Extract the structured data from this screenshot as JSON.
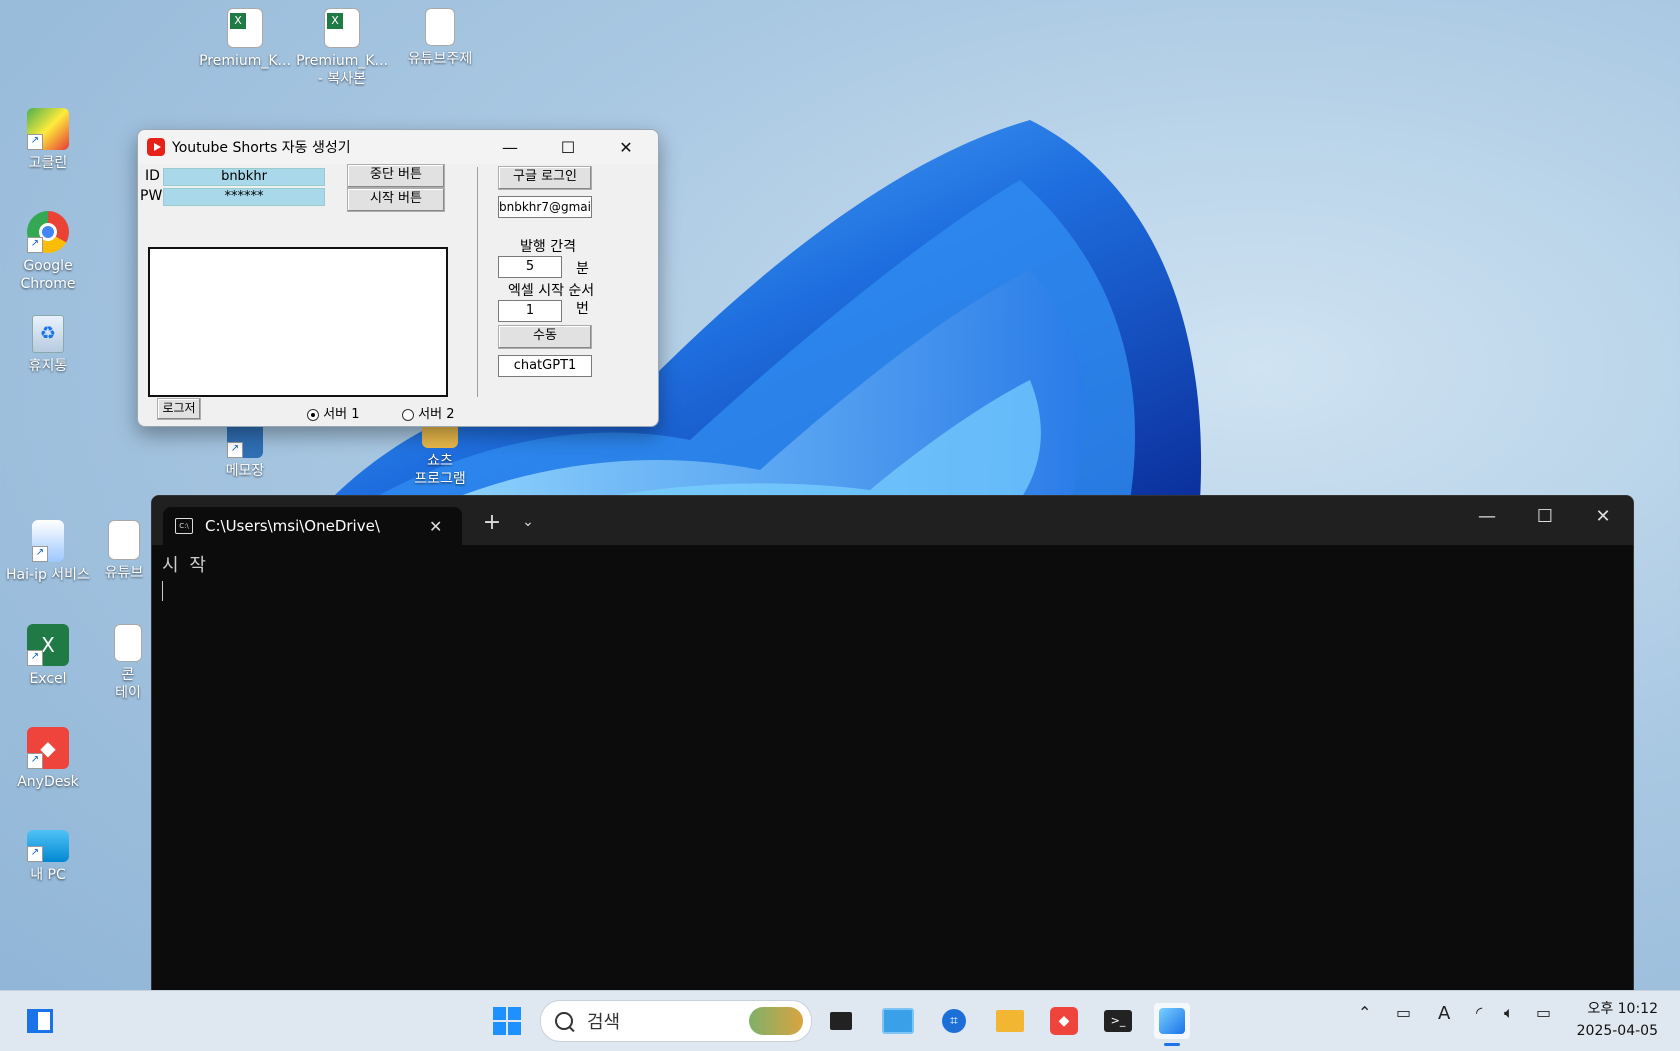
{
  "desktop": {
    "icons": [
      {
        "label": "Premium_K...",
        "label2": ""
      },
      {
        "label": "Premium_K...",
        "label2": "- 복사본"
      },
      {
        "label": "유튜브주제",
        "label2": ""
      },
      {
        "label": "고클린",
        "label2": ""
      },
      {
        "label": "Google",
        "label2": "Chrome"
      },
      {
        "label": "휴지통",
        "label2": ""
      },
      {
        "label": "메모장",
        "label2": ""
      },
      {
        "label": "쇼츠",
        "label2": "프로그램"
      },
      {
        "label": "Hai-ip 서비스",
        "label2": ""
      },
      {
        "label": "유튜브",
        "label2": ""
      },
      {
        "label": "Excel",
        "label2": ""
      },
      {
        "label": "콘",
        "label2": "테이"
      },
      {
        "label": "AnyDesk",
        "label2": ""
      },
      {
        "label": "내 PC",
        "label2": ""
      }
    ]
  },
  "app": {
    "title": "Youtube Shorts 자동 생성기",
    "id_label": "ID",
    "pw_label": "PW",
    "id_value": "bnbkhr",
    "pw_value": "******",
    "stop_button": "중단 버튼",
    "start_button": "시작 버튼",
    "google_login": "구글 로그인",
    "email_value": "bnbkhr7@gmai",
    "interval_label": "발행 간격",
    "interval_value": "5",
    "interval_unit": "분",
    "excel_label": "엑셀 시작 순서",
    "excel_value": "1",
    "excel_unit": "번",
    "manual_button": "수동",
    "gpt_value": "chatGPT1",
    "log_save": "로그저장",
    "server1": "서버 1",
    "server2": "서버 2",
    "colors": {
      "field_bg": "#a8d8ea",
      "yt_red": "#e62117"
    }
  },
  "terminal": {
    "tab_title": "C:\\Users\\msi\\OneDrive\\",
    "output_line": "시 작"
  },
  "taskbar": {
    "search_placeholder": "검색",
    "time": "오후 10:12",
    "date": "2025-04-05"
  }
}
